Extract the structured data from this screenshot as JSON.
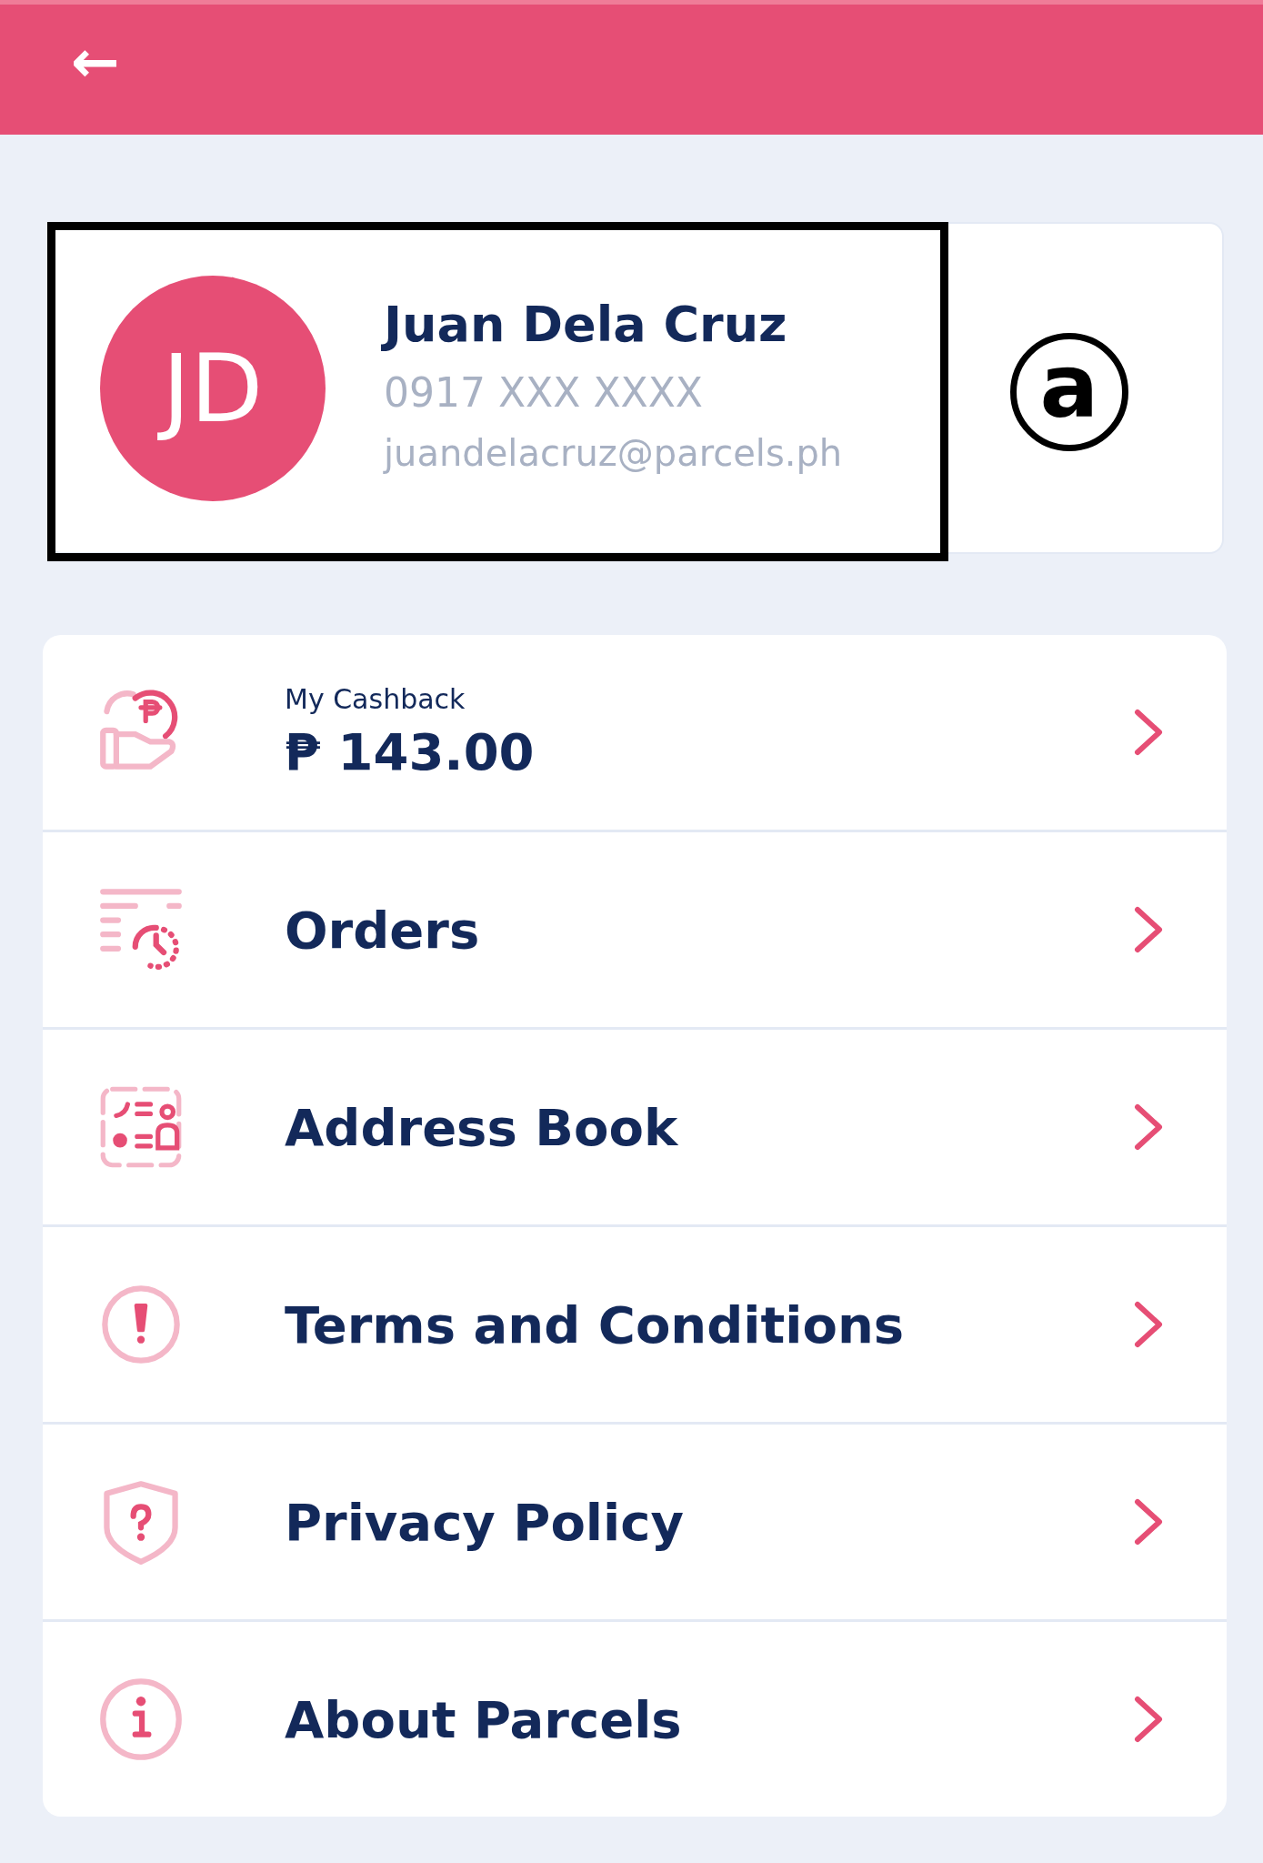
{
  "header": {
    "back": "←"
  },
  "profile": {
    "initials": "JD",
    "name": "Juan Dela Cruz",
    "phone": "0917 XXX XXXX",
    "email": "juandelacruz@parcels.ph"
  },
  "annotation": {
    "label": "a"
  },
  "menu": [
    {
      "kind": "cashback",
      "label": "My Cashback",
      "value": "₱ 143.00"
    },
    {
      "kind": "link",
      "label": "Orders"
    },
    {
      "kind": "link",
      "label": "Address Book"
    },
    {
      "kind": "link",
      "label": "Terms and Conditions"
    },
    {
      "kind": "link",
      "label": "Privacy Policy"
    },
    {
      "kind": "link",
      "label": "About Parcels"
    }
  ]
}
